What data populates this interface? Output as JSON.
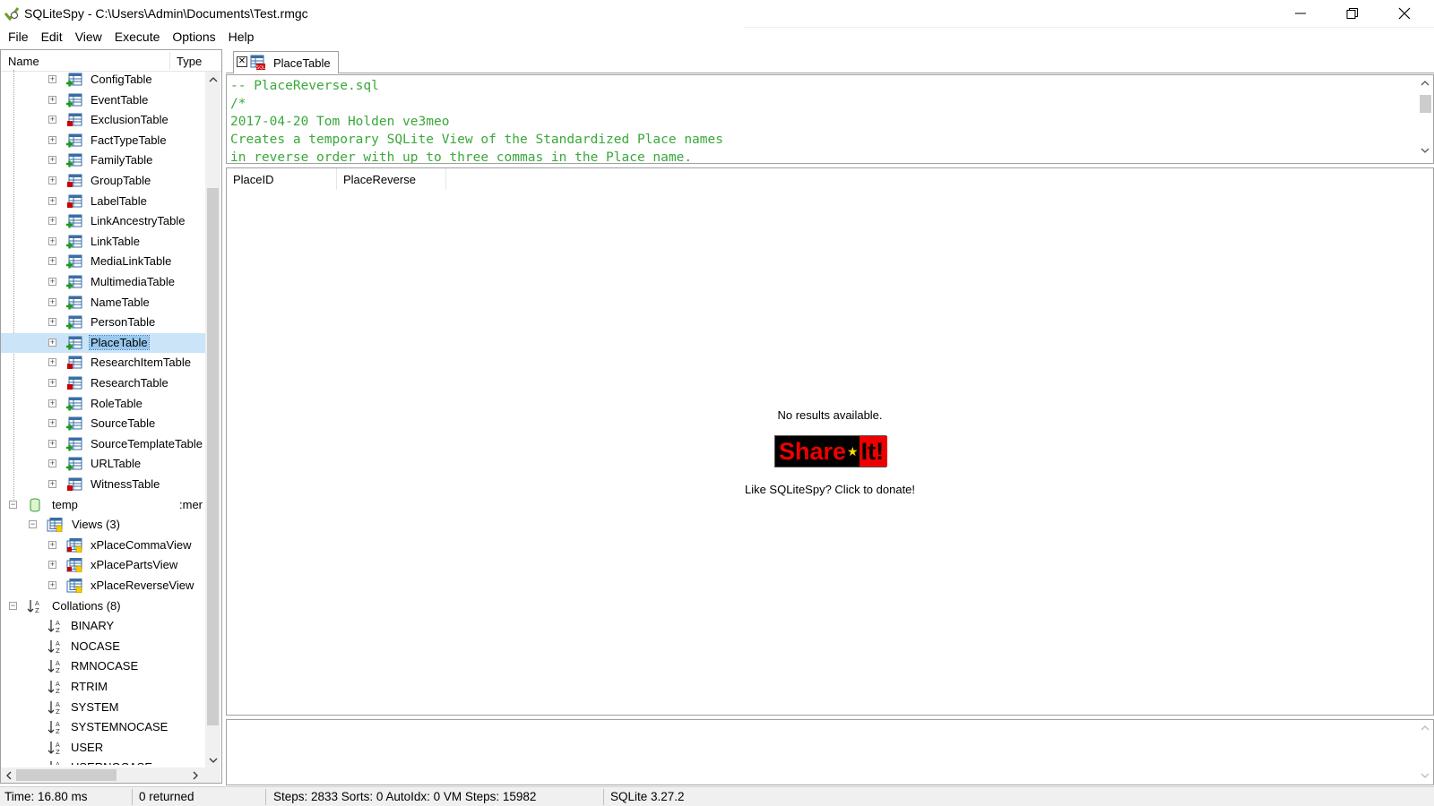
{
  "window": {
    "title": "SQLiteSpy - C:\\Users\\Admin\\Documents\\Test.rmgc"
  },
  "menu": [
    "File",
    "Edit",
    "View",
    "Execute",
    "Options",
    "Help"
  ],
  "tree": {
    "header": {
      "name": "Name",
      "type": "Type"
    },
    "tables": [
      {
        "label": "ConfigTable",
        "icon": "table-green-icon"
      },
      {
        "label": "EventTable",
        "icon": "table-green-icon"
      },
      {
        "label": "ExclusionTable",
        "icon": "table-red-icon"
      },
      {
        "label": "FactTypeTable",
        "icon": "table-green-icon"
      },
      {
        "label": "FamilyTable",
        "icon": "table-green-icon"
      },
      {
        "label": "GroupTable",
        "icon": "table-red-icon"
      },
      {
        "label": "LabelTable",
        "icon": "table-red-icon"
      },
      {
        "label": "LinkAncestryTable",
        "icon": "table-green-icon"
      },
      {
        "label": "LinkTable",
        "icon": "table-green-icon"
      },
      {
        "label": "MediaLinkTable",
        "icon": "table-green-icon"
      },
      {
        "label": "MultimediaTable",
        "icon": "table-green-icon"
      },
      {
        "label": "NameTable",
        "icon": "table-green-icon"
      },
      {
        "label": "PersonTable",
        "icon": "table-green-icon"
      },
      {
        "label": "PlaceTable",
        "icon": "table-green-icon",
        "selected": true
      },
      {
        "label": "ResearchItemTable",
        "icon": "table-red-icon"
      },
      {
        "label": "ResearchTable",
        "icon": "table-red-icon"
      },
      {
        "label": "RoleTable",
        "icon": "table-green-icon"
      },
      {
        "label": "SourceTable",
        "icon": "table-green-icon"
      },
      {
        "label": "SourceTemplateTable",
        "icon": "table-green-icon"
      },
      {
        "label": "URLTable",
        "icon": "table-green-icon"
      },
      {
        "label": "WitnessTable",
        "icon": "table-red-icon"
      }
    ],
    "temp": {
      "label": "temp",
      "type": ":mer"
    },
    "views_group": {
      "label": "Views (3)"
    },
    "views": [
      {
        "label": "xPlaceCommaView",
        "icon": "view-red-icon"
      },
      {
        "label": "xPlacePartsView",
        "icon": "view-red-icon"
      },
      {
        "label": "xPlaceReverseView",
        "icon": "view-icon"
      }
    ],
    "collations_group": {
      "label": "Collations (8)"
    },
    "collations": [
      "BINARY",
      "NOCASE",
      "RMNOCASE",
      "RTRIM",
      "SYSTEM",
      "SYSTEMNOCASE",
      "USER",
      "USERNOCASE"
    ]
  },
  "tab": {
    "label": "PlaceTable"
  },
  "editor": {
    "lines": [
      "-- PlaceReverse.sql",
      "/*",
      "2017-04-20 Tom Holden ve3meo",
      "Creates a temporary SQLite View of the Standardized Place names",
      "in reverse order with up to three commas in the Place name."
    ]
  },
  "results": {
    "columns": [
      "PlaceID",
      "PlaceReverse"
    ],
    "empty_message": "No results available.",
    "share_left": "Share",
    "share_right": "It!",
    "donate_text": "Like SQLiteSpy? Click to donate!"
  },
  "status": {
    "time": "Time: 16.80 ms",
    "returned": "0 returned",
    "steps": "Steps: 2833  Sorts: 0  AutoIdx: 0  VM Steps: 15982",
    "version": "SQLite 3.27.2"
  },
  "colors": {
    "selection": "#cce4f7",
    "code_comment": "#3aa83a",
    "share_red": "#ee0000"
  }
}
